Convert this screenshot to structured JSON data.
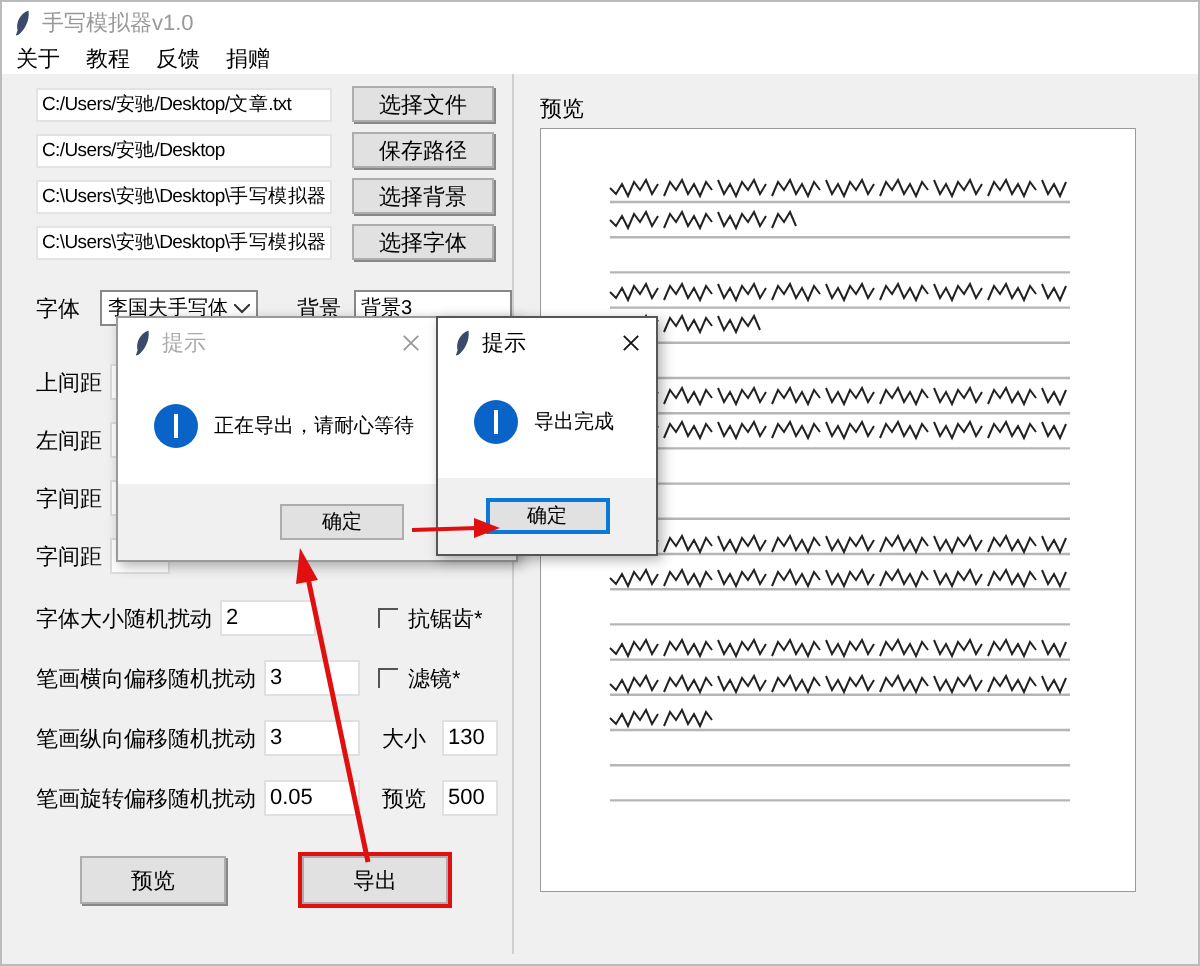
{
  "window": {
    "title": "手写模拟器v1.0"
  },
  "menu": [
    "关于",
    "教程",
    "反馈",
    "捐赠"
  ],
  "paths": [
    {
      "value": "C:/Users/安驰/Desktop/文章.txt",
      "button": "选择文件"
    },
    {
      "value": "C:/Users/安驰/Desktop",
      "button": "保存路径"
    },
    {
      "value": "C:\\Users\\安驰\\Desktop\\手写模拟器",
      "button": "选择背景"
    },
    {
      "value": "C:\\Users\\安驰\\Desktop\\手写模拟器",
      "button": "选择字体"
    }
  ],
  "font": {
    "label": "字体",
    "value": "李国夫手写体"
  },
  "background": {
    "label": "背景",
    "value": "背景3"
  },
  "spacing": [
    {
      "label": "上间距"
    },
    {
      "label": "左间距"
    },
    {
      "label": "字间距"
    },
    {
      "label": "字间距"
    }
  ],
  "jitter": [
    {
      "label": "字体大小随机扰动",
      "value": "2"
    },
    {
      "label": "笔画横向偏移随机扰动",
      "value": "3"
    },
    {
      "label": "笔画纵向偏移随机扰动",
      "value": "3"
    },
    {
      "label": "笔画旋转偏移随机扰动",
      "value": "0.05"
    }
  ],
  "options": [
    {
      "kind": "checkbox",
      "label": "抗锯齿*",
      "checked": false
    },
    {
      "kind": "checkbox",
      "label": "滤镜*",
      "checked": false
    },
    {
      "kind": "field",
      "label": "大小",
      "value": "130"
    },
    {
      "kind": "field",
      "label": "预览",
      "value": "500"
    }
  ],
  "actions": [
    {
      "label": "预览",
      "highlighted": false
    },
    {
      "label": "导出",
      "highlighted": true
    }
  ],
  "preview": {
    "label": "预览",
    "kind": "picture"
  },
  "dialogs": [
    {
      "title": "提示",
      "message": "正在导出，请耐心等待",
      "button": "确定",
      "active": false
    },
    {
      "title": "提示",
      "message": "导出完成",
      "button": "确定",
      "active": true
    }
  ]
}
